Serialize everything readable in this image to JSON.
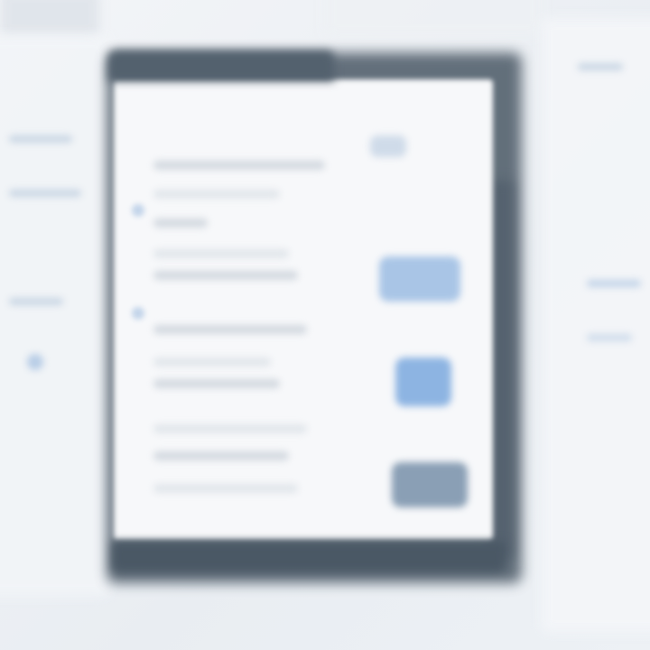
{
  "screen": {
    "description_state": "blurred",
    "accent": "#8db4e2",
    "dark_frame": "#4b5966",
    "paper": "#f7f8fa"
  },
  "document": {
    "title": "",
    "rows": [
      {
        "label": "",
        "action": ""
      },
      {
        "label": "",
        "action": ""
      },
      {
        "label": "",
        "action": ""
      }
    ]
  }
}
